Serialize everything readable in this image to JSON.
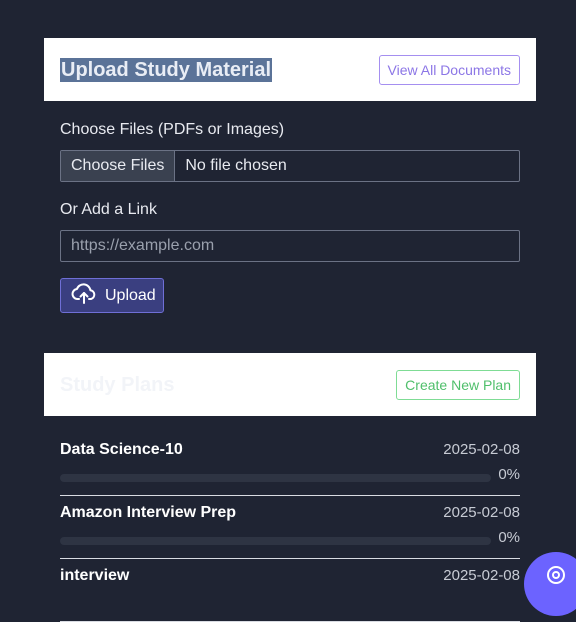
{
  "upload": {
    "title": "Upload Study Material",
    "view_all_label": "View All Documents",
    "files_label": "Choose Files (PDFs or Images)",
    "choose_files_label": "Choose Files",
    "no_file_text": "No file chosen",
    "link_label": "Or Add a Link",
    "link_placeholder": "https://example.com",
    "upload_label": "Upload",
    "upload_icon": "cloud-upload-icon"
  },
  "plans": {
    "title": "Study Plans",
    "create_label": "Create New Plan",
    "items": [
      {
        "name": "Data Science-10",
        "date": "2025-02-08",
        "progress": "0%"
      },
      {
        "name": "Amazon Interview Prep",
        "date": "2025-02-08",
        "progress": "0%"
      },
      {
        "name": "interview",
        "date": "2025-02-08",
        "progress": ""
      }
    ]
  },
  "fab": {
    "icon": "chat-icon"
  },
  "colors": {
    "background": "#1f2433",
    "accent": "#6c63ff",
    "view_all": "#8c76e6",
    "create_plan": "#4fbf6b"
  }
}
